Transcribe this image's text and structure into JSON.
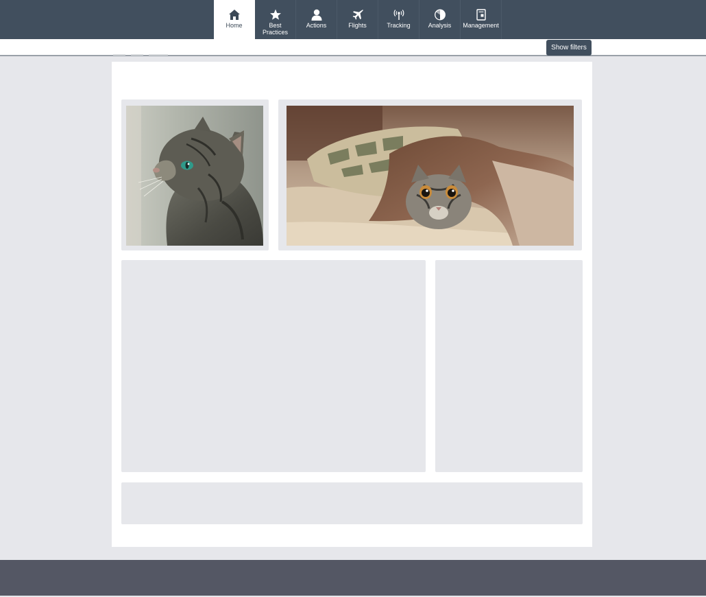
{
  "nav": {
    "items": [
      {
        "label": "Home",
        "icon": "home-icon",
        "active": true
      },
      {
        "label": "Best\nPractices",
        "icon": "star-icon",
        "active": false
      },
      {
        "label": "Actions",
        "icon": "user-icon",
        "active": false
      },
      {
        "label": "Flights",
        "icon": "plane-icon",
        "active": false
      },
      {
        "label": "Tracking",
        "icon": "broadcast-icon",
        "active": false
      },
      {
        "label": "Analysis",
        "icon": "pie-chart-icon",
        "active": false
      },
      {
        "label": "Management",
        "icon": "document-icon",
        "active": false
      }
    ]
  },
  "filters": {
    "button_label": "Show filters"
  },
  "colors": {
    "topbar": "#414f5e",
    "footer": "#545764",
    "page_background": "#e6e7eb",
    "tile": "#e6e7eb"
  },
  "images": {
    "left": "tabby-cat-looking-up",
    "right": "kitten-under-blanket"
  }
}
